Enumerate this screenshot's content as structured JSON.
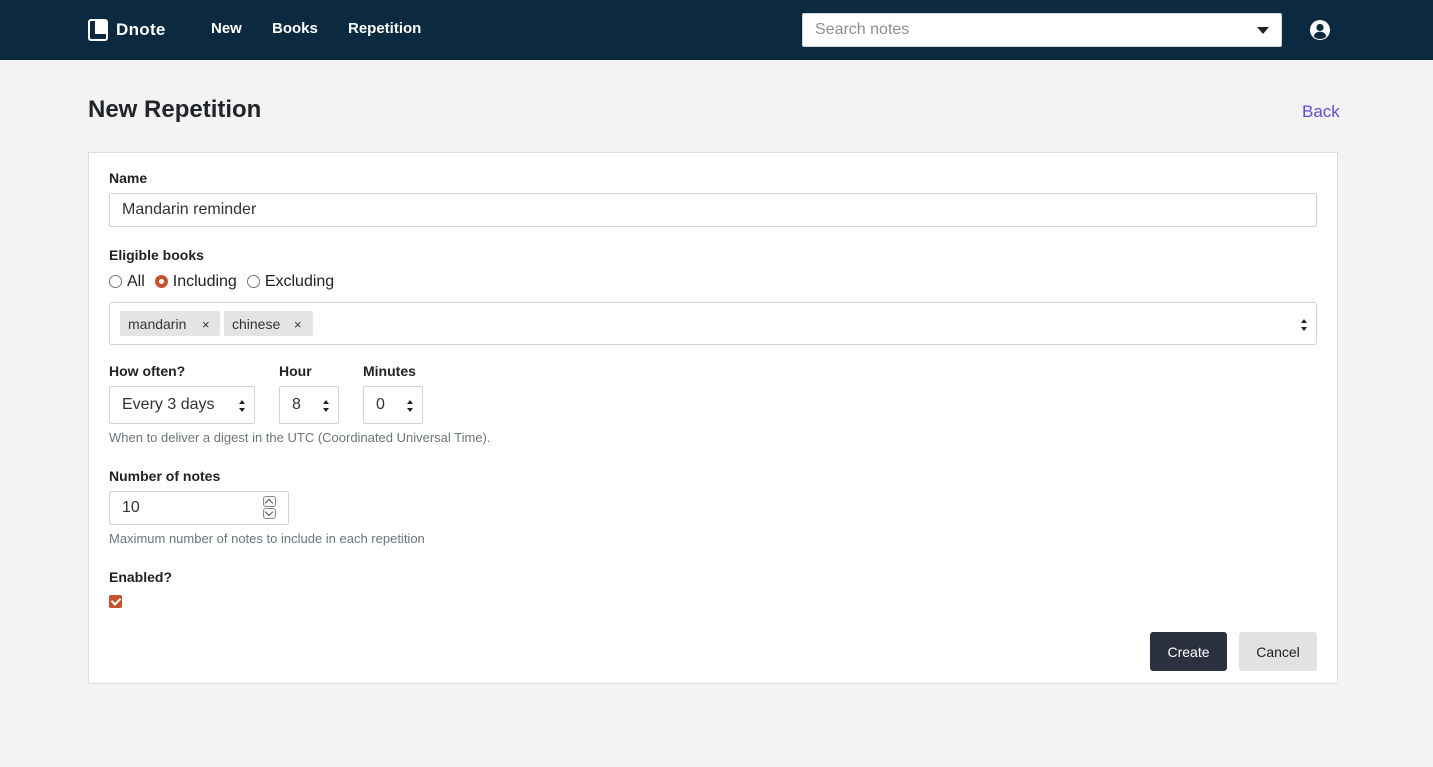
{
  "navbar": {
    "brand": "Dnote",
    "links": [
      "New",
      "Books",
      "Repetition"
    ],
    "search_placeholder": "Search notes"
  },
  "page": {
    "title": "New Repetition",
    "back_label": "Back"
  },
  "form": {
    "name_label": "Name",
    "name_value": "Mandarin reminder",
    "eligible_label": "Eligible books",
    "eligible_options": [
      "All",
      "Including",
      "Excluding"
    ],
    "eligible_selected": "Including",
    "books": [
      "mandarin",
      "chinese"
    ],
    "remove_tag_symbol": "×",
    "frequency_label": "How often?",
    "frequency_value": "Every 3 days",
    "hour_label": "Hour",
    "hour_value": "8",
    "minutes_label": "Minutes",
    "minutes_value": "0",
    "time_help": "When to deliver a digest in the UTC (Coordinated Universal Time).",
    "notes_label": "Number of notes",
    "notes_value": "10",
    "notes_help": "Maximum number of notes to include in each repetition",
    "enabled_label": "Enabled?",
    "enabled": true,
    "create_label": "Create",
    "cancel_label": "Cancel"
  },
  "colors": {
    "navbar_bg": "#0c2a3f",
    "accent": "#c5522f",
    "link": "#5a4fcf",
    "primary_button": "#2c3142"
  },
  "icons": {
    "brand": "dnote-logo-icon",
    "search_dropdown": "caret-down-icon",
    "user": "user-circle-icon"
  }
}
